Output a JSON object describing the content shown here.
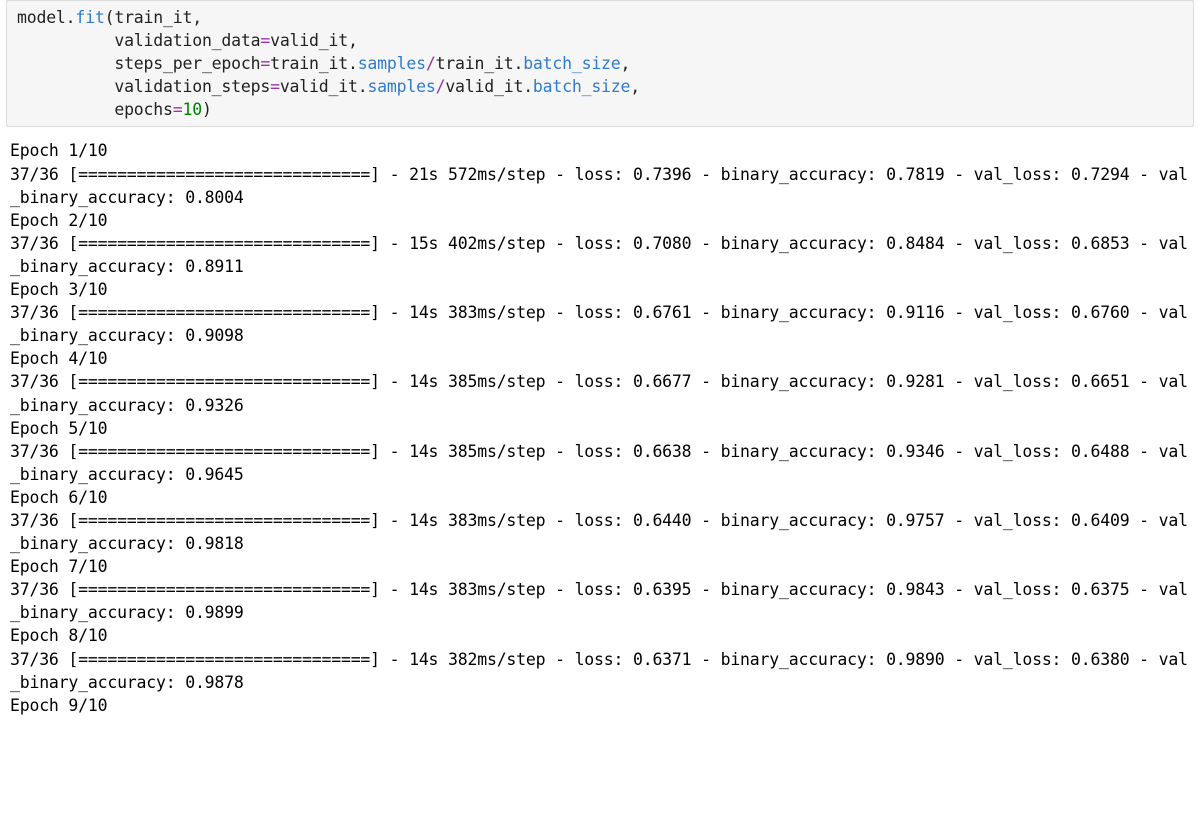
{
  "code": {
    "obj": "model",
    "method": "fit",
    "arg0": "train_it",
    "indent": "          ",
    "kw_validation_data": "validation_data",
    "val_validation_data": "valid_it",
    "kw_steps": "steps_per_epoch",
    "steps_lhs": "train_it",
    "steps_attr1": "samples",
    "steps_rhs": "train_it",
    "steps_attr2": "batch_size",
    "kw_valsteps": "validation_steps",
    "valsteps_lhs": "valid_it",
    "valsteps_attr1": "samples",
    "valsteps_rhs": "valid_it",
    "valsteps_attr2": "batch_size",
    "kw_epochs": "epochs",
    "val_epochs": "10"
  },
  "output": {
    "prog": "37/36",
    "bar": "[==============================]",
    "epochs": [
      {
        "label": "Epoch 1/10",
        "time": "21s 572ms/step",
        "loss": "0.7396",
        "acc": "0.7819",
        "vloss": "0.7294",
        "vacc": "0.8004"
      },
      {
        "label": "Epoch 2/10",
        "time": "15s 402ms/step",
        "loss": "0.7080",
        "acc": "0.8484",
        "vloss": "0.6853",
        "vacc": "0.8911"
      },
      {
        "label": "Epoch 3/10",
        "time": "14s 383ms/step",
        "loss": "0.6761",
        "acc": "0.9116",
        "vloss": "0.6760",
        "vacc": "0.9098"
      },
      {
        "label": "Epoch 4/10",
        "time": "14s 385ms/step",
        "loss": "0.6677",
        "acc": "0.9281",
        "vloss": "0.6651",
        "vacc": "0.9326"
      },
      {
        "label": "Epoch 5/10",
        "time": "14s 385ms/step",
        "loss": "0.6638",
        "acc": "0.9346",
        "vloss": "0.6488",
        "vacc": "0.9645"
      },
      {
        "label": "Epoch 6/10",
        "time": "14s 383ms/step",
        "loss": "0.6440",
        "acc": "0.9757",
        "vloss": "0.6409",
        "vacc": "0.9818"
      },
      {
        "label": "Epoch 7/10",
        "time": "14s 383ms/step",
        "loss": "0.6395",
        "acc": "0.9843",
        "vloss": "0.6375",
        "vacc": "0.9899"
      },
      {
        "label": "Epoch 8/10",
        "time": "14s 382ms/step",
        "loss": "0.6371",
        "acc": "0.9890",
        "vloss": "0.6380",
        "vacc": "0.9878"
      }
    ],
    "trailing_label": "Epoch 9/10"
  }
}
